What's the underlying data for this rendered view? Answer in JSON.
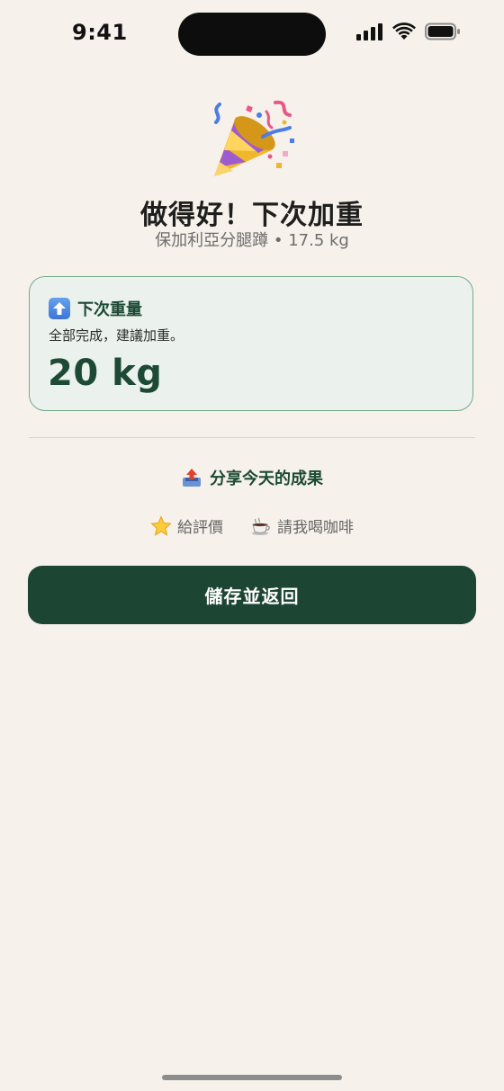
{
  "status_bar": {
    "time": "9:41",
    "icons": [
      "signal-icon",
      "wifi-icon",
      "battery-icon"
    ]
  },
  "header": {
    "icon": "party-popper-icon",
    "title": "做得好！下次加重",
    "subtitle": "保加利亞分腿蹲 • 17.5 kg"
  },
  "next_weight_card": {
    "icon": "up-arrow-icon",
    "title": "下次重量",
    "description": "全部完成，建議加重。",
    "weight": "20 kg"
  },
  "share": {
    "icon": "outbox-tray-icon",
    "label": "分享今天的成果"
  },
  "secondary_links": {
    "rate": {
      "icon": "star-icon",
      "label": "給評價"
    },
    "coffee": {
      "icon": "coffee-icon",
      "label": "請我喝咖啡"
    }
  },
  "primary_button": {
    "label": "儲存並返回"
  },
  "colors": {
    "background": "#f6f1ea",
    "accent_green": "#1d4534",
    "card_background": "#ebf1ec",
    "card_border": "#76a88c"
  }
}
